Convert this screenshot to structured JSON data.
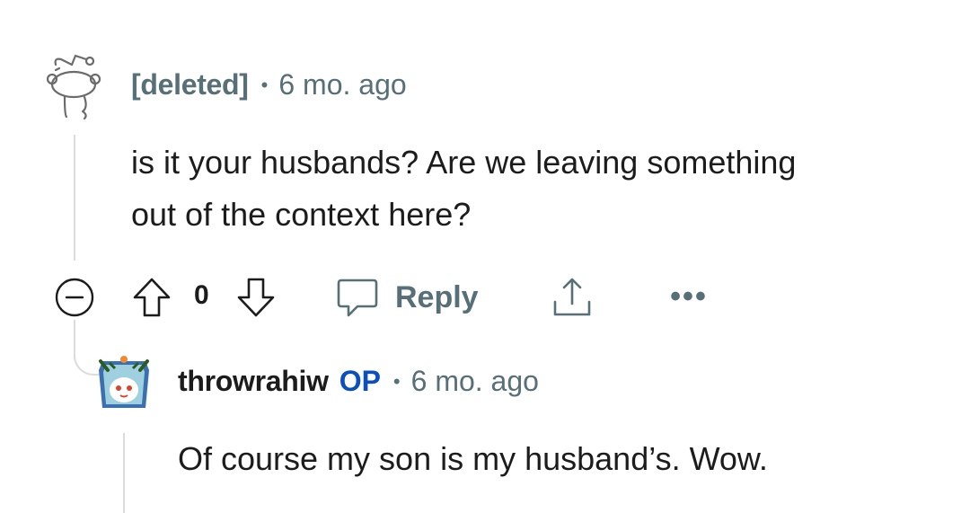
{
  "comment": {
    "author": "[deleted]",
    "separator": "•",
    "age": "6 mo. ago",
    "body_lines": [
      "is it your husbands? Are we leaving something",
      "out of the context here?"
    ],
    "votes": "0",
    "reply_label": "Reply",
    "more_label": "•••",
    "collapse_icon": "minus-circle-icon",
    "upvote_icon": "arrow-up-icon",
    "downvote_icon": "arrow-down-icon",
    "reply_icon": "speech-bubble-icon",
    "share_icon": "share-icon"
  },
  "reply": {
    "author": "throwrahiw",
    "op_badge": "OP",
    "separator": "•",
    "age": "6 mo. ago",
    "body": "Of course my son is my husband’s. Wow."
  },
  "colors": {
    "meta": "#576f76",
    "op_badge": "#0a4fbf",
    "thread_line": "#dcdcdc",
    "avatar_bg": "#3a6fb0"
  }
}
